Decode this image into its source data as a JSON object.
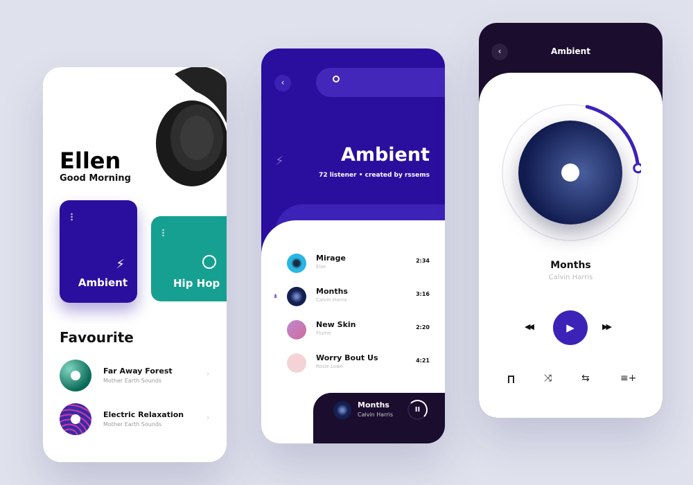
{
  "home": {
    "name": "Ellen",
    "greeting": "Good Morning",
    "cards": [
      {
        "label": "Ambient",
        "icon": "lightning-icon",
        "color": "#2a0f9e"
      },
      {
        "label": "Hip Hop",
        "icon": "basketball-icon",
        "color": "#16a092"
      }
    ],
    "favourite_title": "Favourite",
    "favourites": [
      {
        "title": "Far Away Forest",
        "artist": "Mother Earth Sounds"
      },
      {
        "title": "Electric Relaxation",
        "artist": "Mother Earth Sounds"
      }
    ]
  },
  "playlist": {
    "title": "Ambient",
    "meta": "72 listener • created by rssems",
    "tracks": [
      {
        "title": "Mirage",
        "artist": "Else",
        "duration": "2:34"
      },
      {
        "title": "Months",
        "artist": "Calvin Harris",
        "duration": "3:16",
        "playing": true
      },
      {
        "title": "New Skin",
        "artist": "Flume",
        "duration": "2:20"
      },
      {
        "title": "Worry Bout Us",
        "artist": "Rosie Lowe",
        "duration": "4:21"
      }
    ],
    "now_playing": {
      "title": "Months",
      "artist": "Calvin Harris"
    }
  },
  "player": {
    "header": "Ambient",
    "title": "Months",
    "artist": "Calvin Harris",
    "progress": 0.2
  },
  "colors": {
    "accent": "#3d22b8",
    "teal": "#16a092",
    "dark": "#1a0d2e"
  }
}
